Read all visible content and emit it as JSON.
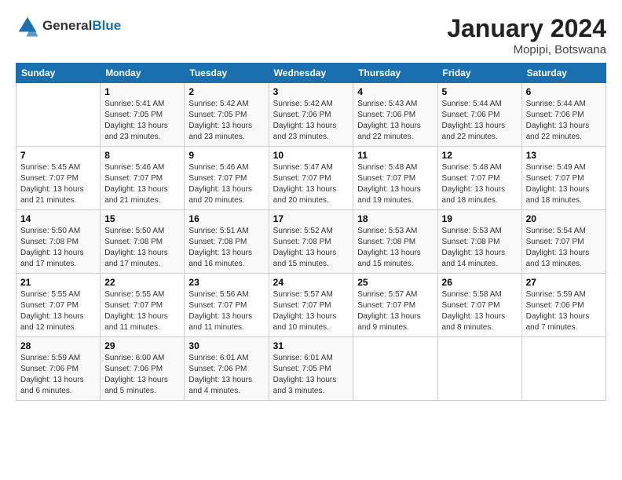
{
  "header": {
    "logo_general": "General",
    "logo_blue": "Blue",
    "month_year": "January 2024",
    "location": "Mopipi, Botswana"
  },
  "columns": [
    "Sunday",
    "Monday",
    "Tuesday",
    "Wednesday",
    "Thursday",
    "Friday",
    "Saturday"
  ],
  "weeks": [
    [
      {
        "num": "",
        "sunrise": "",
        "sunset": "",
        "daylight": ""
      },
      {
        "num": "1",
        "sunrise": "Sunrise: 5:41 AM",
        "sunset": "Sunset: 7:05 PM",
        "daylight": "Daylight: 13 hours and 23 minutes."
      },
      {
        "num": "2",
        "sunrise": "Sunrise: 5:42 AM",
        "sunset": "Sunset: 7:05 PM",
        "daylight": "Daylight: 13 hours and 23 minutes."
      },
      {
        "num": "3",
        "sunrise": "Sunrise: 5:42 AM",
        "sunset": "Sunset: 7:06 PM",
        "daylight": "Daylight: 13 hours and 23 minutes."
      },
      {
        "num": "4",
        "sunrise": "Sunrise: 5:43 AM",
        "sunset": "Sunset: 7:06 PM",
        "daylight": "Daylight: 13 hours and 22 minutes."
      },
      {
        "num": "5",
        "sunrise": "Sunrise: 5:44 AM",
        "sunset": "Sunset: 7:06 PM",
        "daylight": "Daylight: 13 hours and 22 minutes."
      },
      {
        "num": "6",
        "sunrise": "Sunrise: 5:44 AM",
        "sunset": "Sunset: 7:06 PM",
        "daylight": "Daylight: 13 hours and 22 minutes."
      }
    ],
    [
      {
        "num": "7",
        "sunrise": "Sunrise: 5:45 AM",
        "sunset": "Sunset: 7:07 PM",
        "daylight": "Daylight: 13 hours and 21 minutes."
      },
      {
        "num": "8",
        "sunrise": "Sunrise: 5:46 AM",
        "sunset": "Sunset: 7:07 PM",
        "daylight": "Daylight: 13 hours and 21 minutes."
      },
      {
        "num": "9",
        "sunrise": "Sunrise: 5:46 AM",
        "sunset": "Sunset: 7:07 PM",
        "daylight": "Daylight: 13 hours and 20 minutes."
      },
      {
        "num": "10",
        "sunrise": "Sunrise: 5:47 AM",
        "sunset": "Sunset: 7:07 PM",
        "daylight": "Daylight: 13 hours and 20 minutes."
      },
      {
        "num": "11",
        "sunrise": "Sunrise: 5:48 AM",
        "sunset": "Sunset: 7:07 PM",
        "daylight": "Daylight: 13 hours and 19 minutes."
      },
      {
        "num": "12",
        "sunrise": "Sunrise: 5:48 AM",
        "sunset": "Sunset: 7:07 PM",
        "daylight": "Daylight: 13 hours and 18 minutes."
      },
      {
        "num": "13",
        "sunrise": "Sunrise: 5:49 AM",
        "sunset": "Sunset: 7:07 PM",
        "daylight": "Daylight: 13 hours and 18 minutes."
      }
    ],
    [
      {
        "num": "14",
        "sunrise": "Sunrise: 5:50 AM",
        "sunset": "Sunset: 7:08 PM",
        "daylight": "Daylight: 13 hours and 17 minutes."
      },
      {
        "num": "15",
        "sunrise": "Sunrise: 5:50 AM",
        "sunset": "Sunset: 7:08 PM",
        "daylight": "Daylight: 13 hours and 17 minutes."
      },
      {
        "num": "16",
        "sunrise": "Sunrise: 5:51 AM",
        "sunset": "Sunset: 7:08 PM",
        "daylight": "Daylight: 13 hours and 16 minutes."
      },
      {
        "num": "17",
        "sunrise": "Sunrise: 5:52 AM",
        "sunset": "Sunset: 7:08 PM",
        "daylight": "Daylight: 13 hours and 15 minutes."
      },
      {
        "num": "18",
        "sunrise": "Sunrise: 5:53 AM",
        "sunset": "Sunset: 7:08 PM",
        "daylight": "Daylight: 13 hours and 15 minutes."
      },
      {
        "num": "19",
        "sunrise": "Sunrise: 5:53 AM",
        "sunset": "Sunset: 7:08 PM",
        "daylight": "Daylight: 13 hours and 14 minutes."
      },
      {
        "num": "20",
        "sunrise": "Sunrise: 5:54 AM",
        "sunset": "Sunset: 7:07 PM",
        "daylight": "Daylight: 13 hours and 13 minutes."
      }
    ],
    [
      {
        "num": "21",
        "sunrise": "Sunrise: 5:55 AM",
        "sunset": "Sunset: 7:07 PM",
        "daylight": "Daylight: 13 hours and 12 minutes."
      },
      {
        "num": "22",
        "sunrise": "Sunrise: 5:55 AM",
        "sunset": "Sunset: 7:07 PM",
        "daylight": "Daylight: 13 hours and 11 minutes."
      },
      {
        "num": "23",
        "sunrise": "Sunrise: 5:56 AM",
        "sunset": "Sunset: 7:07 PM",
        "daylight": "Daylight: 13 hours and 11 minutes."
      },
      {
        "num": "24",
        "sunrise": "Sunrise: 5:57 AM",
        "sunset": "Sunset: 7:07 PM",
        "daylight": "Daylight: 13 hours and 10 minutes."
      },
      {
        "num": "25",
        "sunrise": "Sunrise: 5:57 AM",
        "sunset": "Sunset: 7:07 PM",
        "daylight": "Daylight: 13 hours and 9 minutes."
      },
      {
        "num": "26",
        "sunrise": "Sunrise: 5:58 AM",
        "sunset": "Sunset: 7:07 PM",
        "daylight": "Daylight: 13 hours and 8 minutes."
      },
      {
        "num": "27",
        "sunrise": "Sunrise: 5:59 AM",
        "sunset": "Sunset: 7:06 PM",
        "daylight": "Daylight: 13 hours and 7 minutes."
      }
    ],
    [
      {
        "num": "28",
        "sunrise": "Sunrise: 5:59 AM",
        "sunset": "Sunset: 7:06 PM",
        "daylight": "Daylight: 13 hours and 6 minutes."
      },
      {
        "num": "29",
        "sunrise": "Sunrise: 6:00 AM",
        "sunset": "Sunset: 7:06 PM",
        "daylight": "Daylight: 13 hours and 5 minutes."
      },
      {
        "num": "30",
        "sunrise": "Sunrise: 6:01 AM",
        "sunset": "Sunset: 7:06 PM",
        "daylight": "Daylight: 13 hours and 4 minutes."
      },
      {
        "num": "31",
        "sunrise": "Sunrise: 6:01 AM",
        "sunset": "Sunset: 7:05 PM",
        "daylight": "Daylight: 13 hours and 3 minutes."
      },
      {
        "num": "",
        "sunrise": "",
        "sunset": "",
        "daylight": ""
      },
      {
        "num": "",
        "sunrise": "",
        "sunset": "",
        "daylight": ""
      },
      {
        "num": "",
        "sunrise": "",
        "sunset": "",
        "daylight": ""
      }
    ]
  ]
}
